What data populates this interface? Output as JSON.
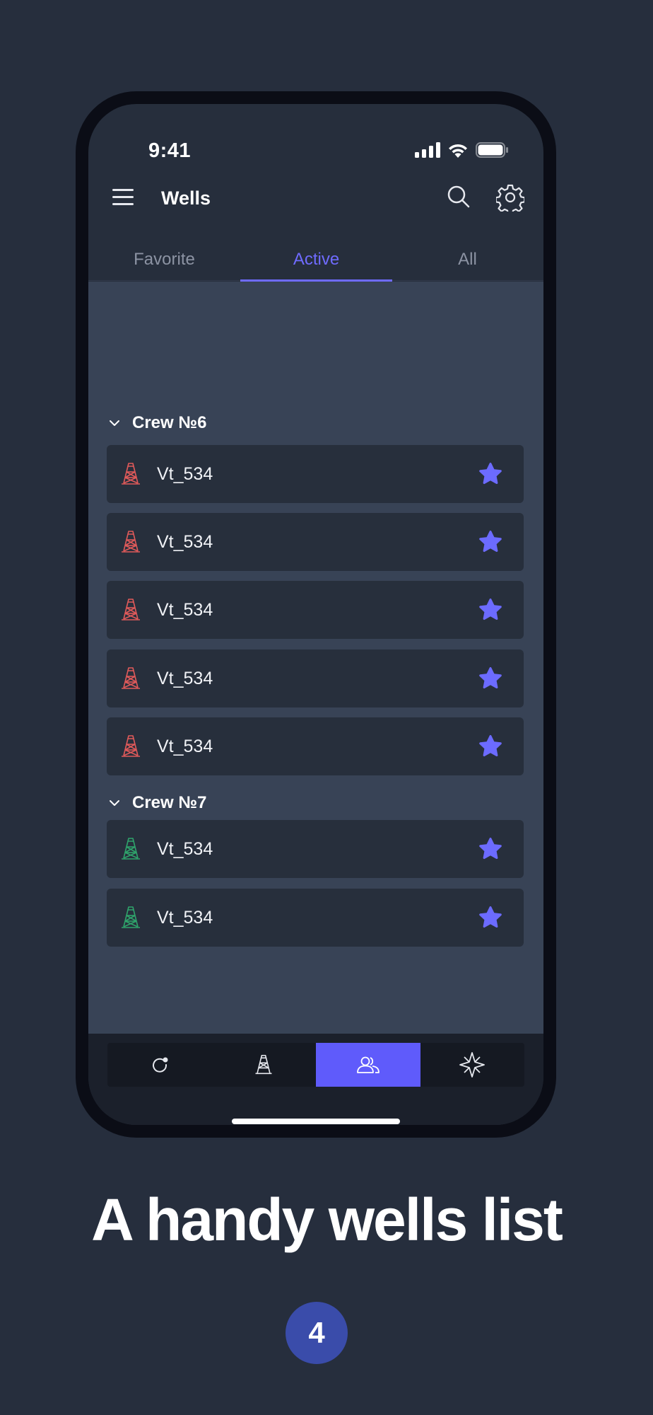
{
  "status_bar": {
    "time": "9:41"
  },
  "header": {
    "title": "Wells"
  },
  "tabs": [
    {
      "label": "Favorite",
      "active": false
    },
    {
      "label": "Active",
      "active": true
    },
    {
      "label": "All",
      "active": false
    }
  ],
  "groups": [
    {
      "title": "Crew №6",
      "rig_color": "#E05A5A",
      "wells": [
        {
          "name": "Vt_534",
          "favorite": true
        },
        {
          "name": "Vt_534",
          "favorite": true
        },
        {
          "name": "Vt_534",
          "favorite": true
        },
        {
          "name": "Vt_534",
          "favorite": true
        },
        {
          "name": "Vt_534",
          "favorite": true
        }
      ]
    },
    {
      "title": "Crew №7",
      "rig_color": "#2FA36B",
      "wells": [
        {
          "name": "Vt_534",
          "favorite": true
        },
        {
          "name": "Vt_534",
          "favorite": true
        }
      ]
    }
  ],
  "bottom_nav": [
    {
      "icon": "refresh-icon",
      "active": false
    },
    {
      "icon": "oil-rig-icon",
      "active": false
    },
    {
      "icon": "users-icon",
      "active": true
    },
    {
      "icon": "compass-icon",
      "active": false
    }
  ],
  "caption": "A handy wells list",
  "page_number": "4",
  "colors": {
    "accent": "#6F6BFF",
    "star": "#6C6BFF",
    "badge": "#3A4CAA"
  }
}
